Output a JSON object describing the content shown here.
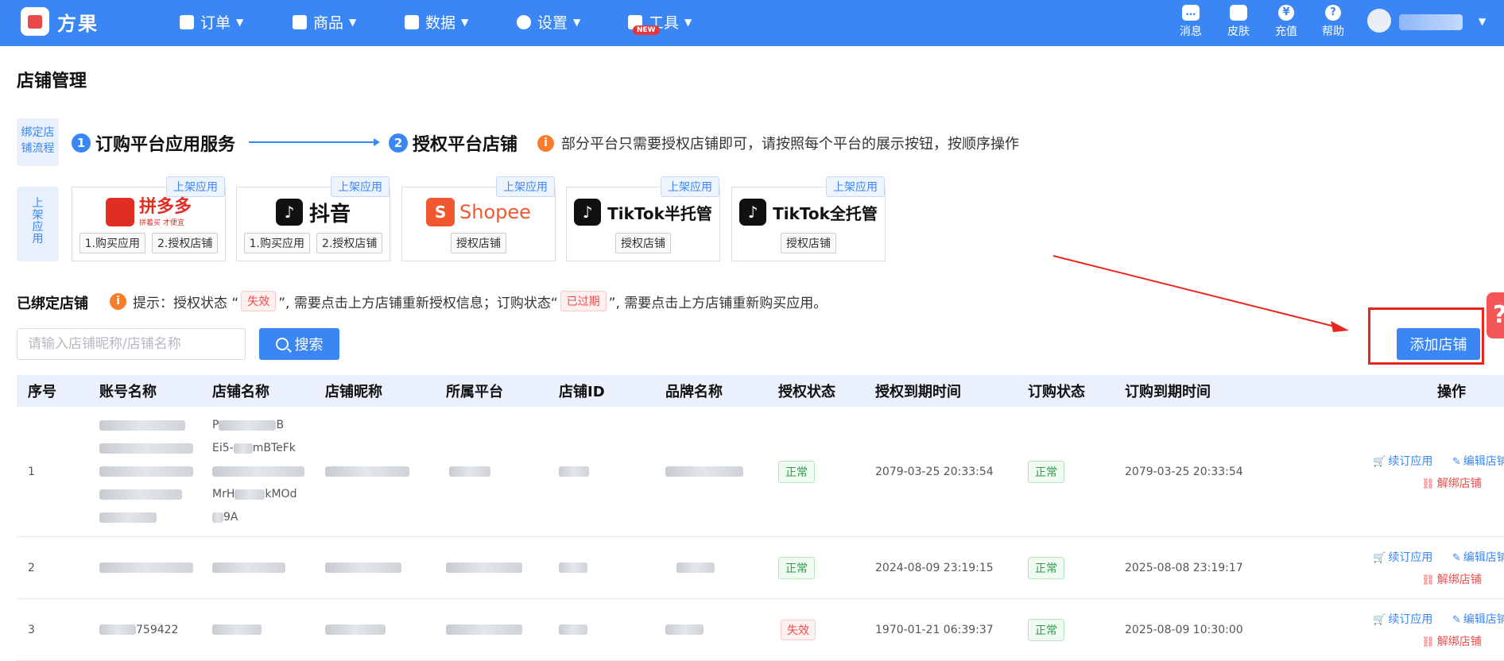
{
  "brand": {
    "name": "方果"
  },
  "nav": [
    {
      "label": "订单",
      "icon": "clipboard-icon"
    },
    {
      "label": "商品",
      "icon": "bag-icon"
    },
    {
      "label": "数据",
      "icon": "chart-icon"
    },
    {
      "label": "设置",
      "icon": "gear-icon"
    },
    {
      "label": "工具",
      "icon": "box-icon",
      "badge": "NEW"
    }
  ],
  "header_right": {
    "items": [
      {
        "label": "消息",
        "icon": "message-icon"
      },
      {
        "label": "皮肤",
        "icon": "shirt-icon"
      },
      {
        "label": "充值",
        "icon": "yen-icon"
      },
      {
        "label": "帮助",
        "icon": "help-icon"
      }
    ]
  },
  "page_title": "店铺管理",
  "flow": {
    "tag": "绑定店铺流程",
    "step1": {
      "num": "1",
      "label": "订购平台应用服务"
    },
    "step2": {
      "num": "2",
      "label": "授权平台店铺"
    },
    "tip": "部分平台只需要授权店铺即可，请按照每个平台的展示按钮，按顺序操作"
  },
  "shelf_tag": "上架应用",
  "platforms": [
    {
      "name": "拼多多",
      "sub": "拼着买 才便宜",
      "tag": "上架应用",
      "buttons": [
        "1.购买应用",
        "2.授权店铺"
      ]
    },
    {
      "name": "抖音",
      "tag": "上架应用",
      "buttons": [
        "1.购买应用",
        "2.授权店铺"
      ]
    },
    {
      "name": "Shopee",
      "tag": "上架应用",
      "buttons": [
        "授权店铺"
      ]
    },
    {
      "name": "TikTok半托管",
      "tag": "上架应用",
      "buttons": [
        "授权店铺"
      ]
    },
    {
      "name": "TikTok全托管",
      "tag": "上架应用",
      "buttons": [
        "授权店铺"
      ]
    }
  ],
  "bound": {
    "title": "已绑定店铺",
    "notice_prefix": "提示：授权状态 “",
    "notice_tag1": "失效",
    "notice_mid": "”, 需要点击上方店铺重新授权信息；订购状态“",
    "notice_tag2": "已过期",
    "notice_suffix": "”, 需要点击上方店铺重新购买应用。"
  },
  "search": {
    "placeholder": "请输入店铺昵称/店铺名称",
    "button": "搜索"
  },
  "add_shop": "添加店铺",
  "table": {
    "headers": [
      "序号",
      "账号名称",
      "店铺名称",
      "店铺昵称",
      "所属平台",
      "店铺ID",
      "品牌名称",
      "授权状态",
      "授权到期时间",
      "订购状态",
      "订购到期时间",
      "操作"
    ],
    "rows": [
      {
        "index": "1",
        "shop_name_lines": [
          "P",
          "B",
          "Ei5-",
          "mBTeFk",
          "",
          "MrH",
          "kMOd",
          "9A"
        ],
        "auth_status": "正常",
        "auth_expire": "2079-03-25 20:33:54",
        "order_status": "正常",
        "order_expire": "2079-03-25 20:33:54"
      },
      {
        "index": "2",
        "auth_status": "正常",
        "auth_expire": "2024-08-09 23:19:15",
        "order_status": "正常",
        "order_expire": "2025-08-08 23:19:17"
      },
      {
        "index": "3",
        "account_partial": "759422",
        "auth_status": "失效",
        "auth_expire": "1970-01-21 06:39:37",
        "order_status": "正常",
        "order_expire": "2025-08-09 10:30:00"
      }
    ],
    "actions": {
      "renew": "续订应用",
      "edit": "编辑店铺信息",
      "unbind": "解绑店铺"
    }
  },
  "colors": {
    "primary": "#3a86f5",
    "danger": "#f04a4a",
    "success": "#2e9e4b",
    "annotation": "#e8281e"
  }
}
